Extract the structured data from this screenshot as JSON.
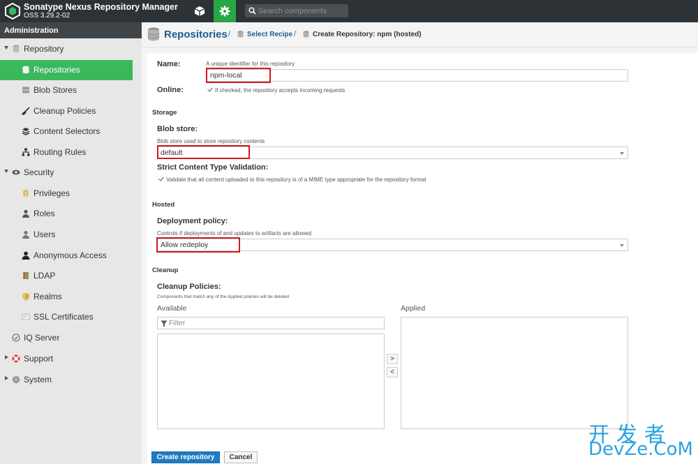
{
  "topbar": {
    "title": "Sonatype Nexus Repository Manager",
    "version": "OSS 3.29.2-02",
    "search_placeholder": "Search components",
    "accent_color": "#28a745"
  },
  "sidebar": {
    "header": "Administration",
    "items": [
      {
        "label": "Repository",
        "icon": "database-icon",
        "level": 0,
        "expanded": true
      },
      {
        "label": "Repositories",
        "icon": "database-icon",
        "level": 1,
        "active": true
      },
      {
        "label": "Blob Stores",
        "icon": "server-icon",
        "level": 1
      },
      {
        "label": "Cleanup Policies",
        "icon": "broom-icon",
        "level": 1
      },
      {
        "label": "Content Selectors",
        "icon": "layers-icon",
        "level": 1
      },
      {
        "label": "Routing Rules",
        "icon": "sitemap-icon",
        "level": 1
      },
      {
        "label": "Security",
        "icon": "eye-icon",
        "level": 0,
        "expanded": true
      },
      {
        "label": "Privileges",
        "icon": "medal-icon",
        "level": 1
      },
      {
        "label": "Roles",
        "icon": "user-tie-icon",
        "level": 1
      },
      {
        "label": "Users",
        "icon": "users-icon",
        "level": 1
      },
      {
        "label": "Anonymous Access",
        "icon": "user-secret-icon",
        "level": 1
      },
      {
        "label": "LDAP",
        "icon": "book-icon",
        "level": 1
      },
      {
        "label": "Realms",
        "icon": "shield-icon",
        "level": 1
      },
      {
        "label": "SSL Certificates",
        "icon": "certificate-icon",
        "level": 1
      },
      {
        "label": "IQ Server",
        "icon": "iq-icon",
        "level": 0
      },
      {
        "label": "Support",
        "icon": "support-icon",
        "level": 0,
        "expanded": false
      },
      {
        "label": "System",
        "icon": "gear-icon",
        "level": 0,
        "expanded": false
      }
    ]
  },
  "breadcrumb": {
    "title": "Repositories",
    "sep": "/",
    "link": "Select Recipe",
    "current": "Create Repository: npm (hosted)"
  },
  "form": {
    "name_label": "Name:",
    "name_help": "A unique identifier for this repository",
    "name_value": "npm-local",
    "online_label": "Online:",
    "online_help": "If checked, the repository accepts incoming requests",
    "storage_title": "Storage",
    "blob_label": "Blob store:",
    "blob_help": "Blob store used to store repository contents",
    "blob_value": "default",
    "strict_label": "Strict Content Type Validation:",
    "strict_help": "Validate that all content uploaded to this repository is of a MIME type appropriate for the repository format",
    "hosted_title": "Hosted",
    "deploy_label": "Deployment policy:",
    "deploy_help": "Controls if deployments of and updates to artifacts are allowed",
    "deploy_value": "Allow redeploy",
    "cleanup_title": "Cleanup",
    "cleanup_label": "Cleanup Policies:",
    "cleanup_help": "Components that match any of the Applied policies will be deleted",
    "available_label": "Available",
    "applied_label": "Applied",
    "filter_placeholder": "Filter",
    "move_right": ">",
    "move_left": "<",
    "create_button": "Create repository",
    "cancel_button": "Cancel"
  },
  "watermark": {
    "line1": "开发者",
    "line2": "DevZe.CoM"
  }
}
